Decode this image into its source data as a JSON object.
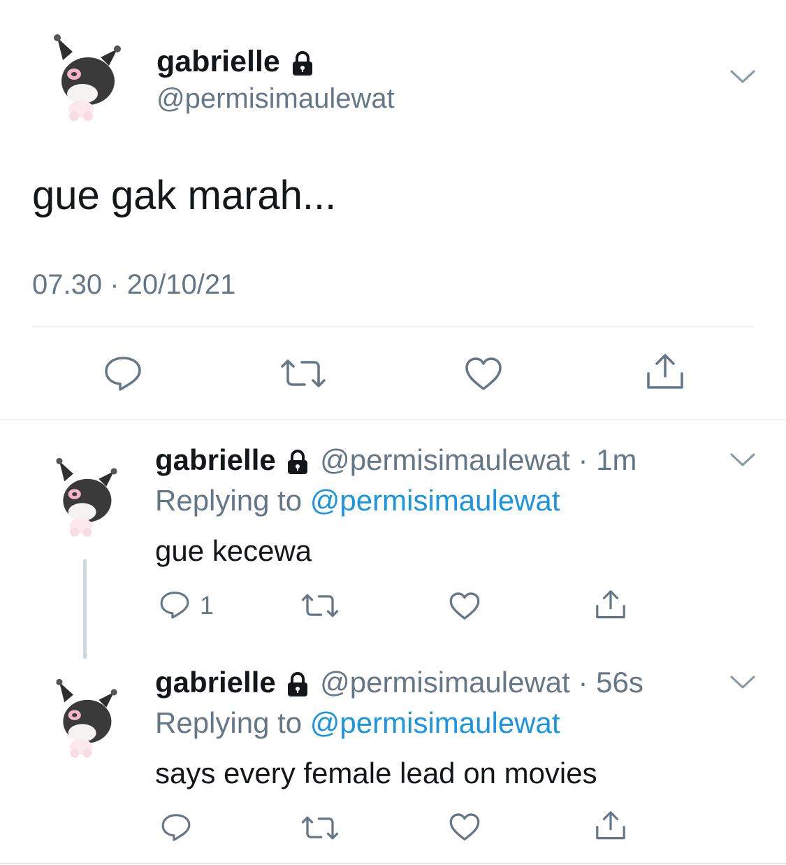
{
  "main_tweet": {
    "display_name": "gabrielle",
    "handle": "@permisimaulewat",
    "text": "gue gak marah...",
    "timestamp": "07.30 · 20/10/21"
  },
  "replies": [
    {
      "display_name": "gabrielle",
      "handle": "@permisimaulewat",
      "time": "· 1m",
      "replying_prefix": "Replying to",
      "replying_to": "@permisimaulewat",
      "text": "gue kecewa",
      "reply_count": "1"
    },
    {
      "display_name": "gabrielle",
      "handle": "@permisimaulewat",
      "time": "· 56s",
      "replying_prefix": "Replying to",
      "replying_to": "@permisimaulewat",
      "text": "says every female lead on movies"
    }
  ],
  "icons": [
    "avatar",
    "lock-icon",
    "chevron-down-icon",
    "reply-icon",
    "retweet-icon",
    "like-icon",
    "share-icon"
  ],
  "colors": {
    "text": "#14171a",
    "secondary": "#657786",
    "link": "#1b95e0",
    "divider": "#d9dee2",
    "thread_line": "#ccd6dd"
  }
}
